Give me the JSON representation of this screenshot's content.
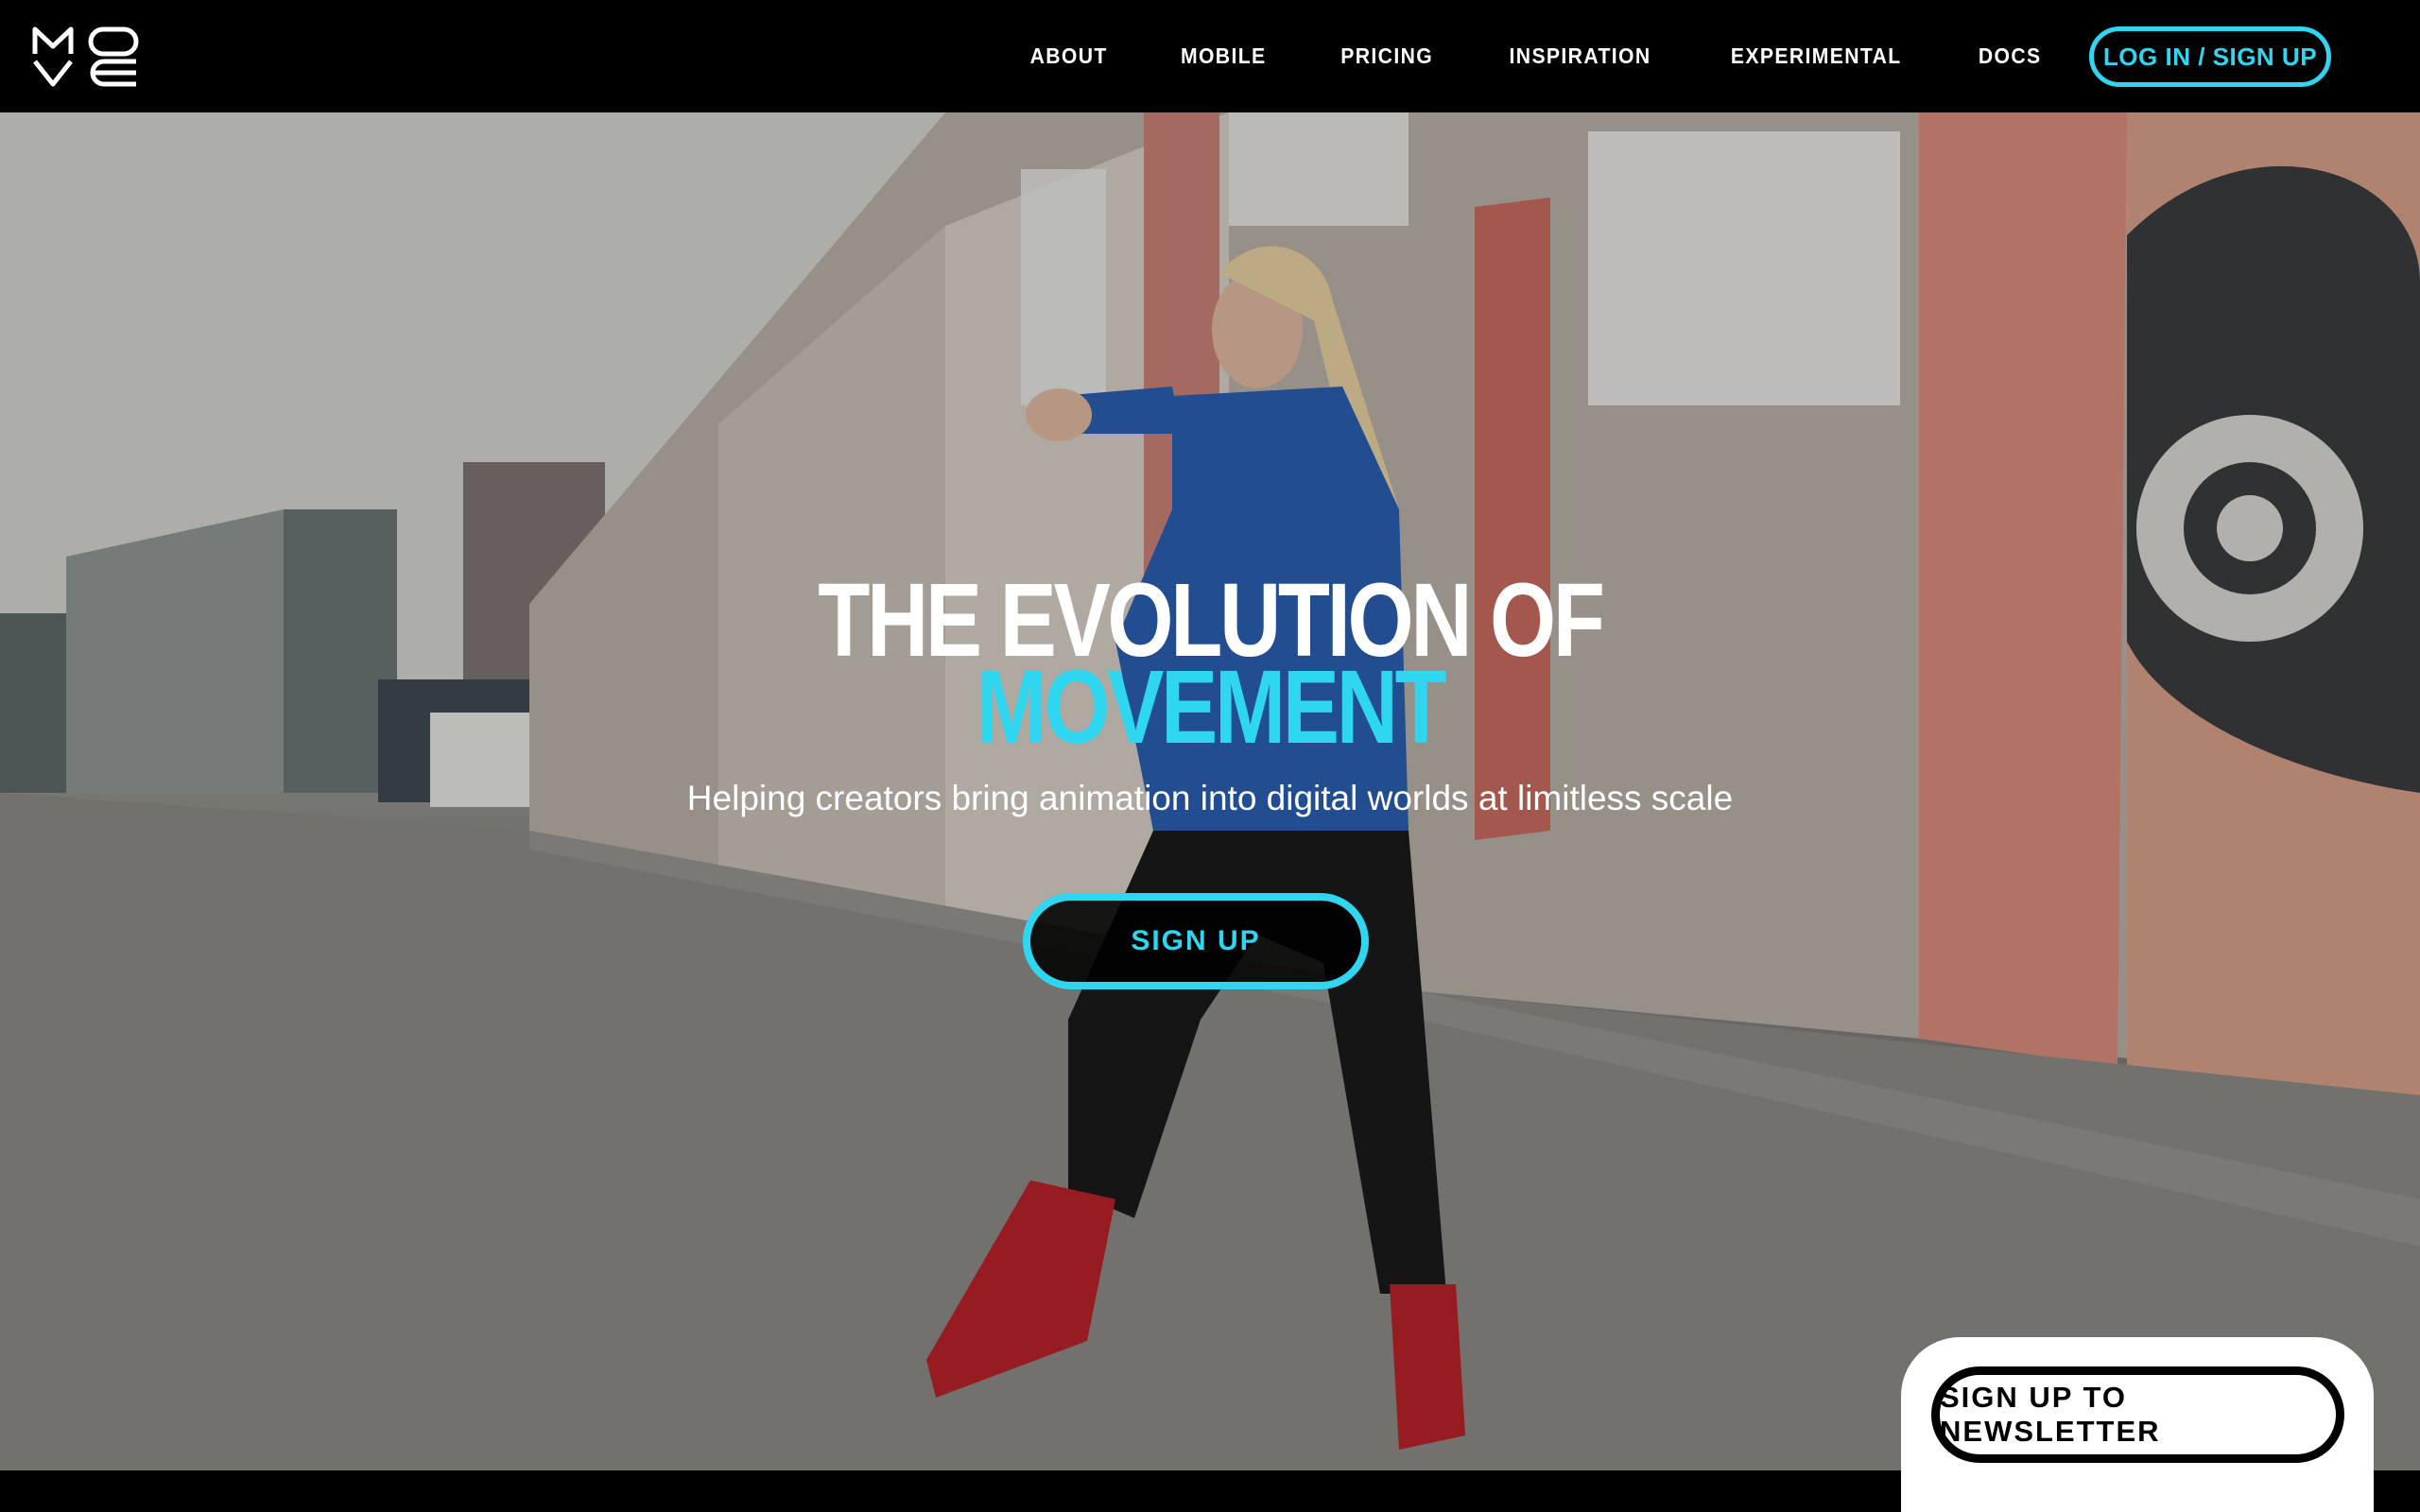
{
  "brand": {
    "logo_icon": "move-logo",
    "logo_letters": "MOVE"
  },
  "nav": {
    "items": [
      {
        "label": "ABOUT"
      },
      {
        "label": "MOBILE"
      },
      {
        "label": "PRICING"
      },
      {
        "label": "INSPIRATION"
      },
      {
        "label": "EXPERIMENTAL"
      },
      {
        "label": "DOCS"
      }
    ],
    "login_label": "LOG IN / SIGN UP"
  },
  "hero": {
    "title_line1": "THE EVOLUTION OF",
    "title_line2": "MOVEMENT",
    "subtitle": "Helping creators bring animation into digital worlds at limitless scale",
    "cta_label": "SIGN UP",
    "background": "video-frame-dancer-street-graffiti"
  },
  "newsletter": {
    "label": "SIGN UP TO NEWSLETTER"
  },
  "colors": {
    "accent": "#2ed6f0",
    "nav_bg": "#000000",
    "text": "#ffffff"
  }
}
